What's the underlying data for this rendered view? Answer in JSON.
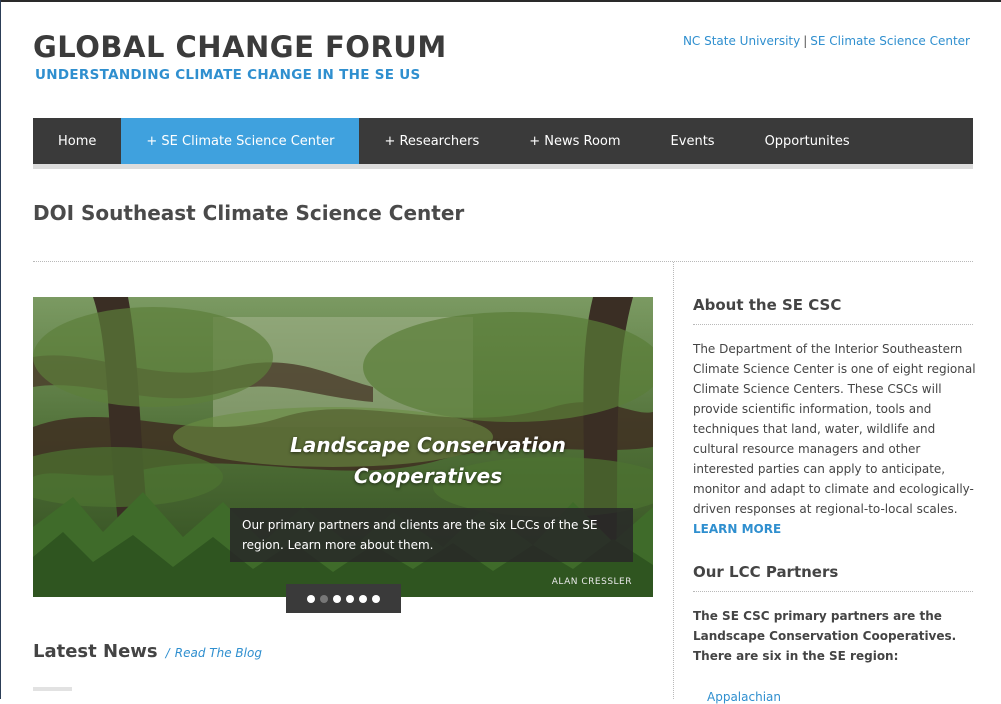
{
  "header": {
    "title": "GLOBAL CHANGE FORUM",
    "tagline": "UNDERSTANDING CLIMATE CHANGE IN THE SE US",
    "links": [
      "NC State University",
      "SE Climate Science Center"
    ],
    "link_separator": "|"
  },
  "nav": {
    "items": [
      "Home",
      "+ SE Climate Science Center",
      "+ Researchers",
      "+ News Room",
      "Events",
      "Opportunites"
    ],
    "active_index": 1
  },
  "page": {
    "title": "DOI Southeast Climate Science Center"
  },
  "slider": {
    "heading_line1": "Landscape Conservation",
    "heading_line2": "Cooperatives",
    "caption": "Our primary partners and clients are the six LCCs of the SE region. Learn more about them.",
    "credit": "ALAN CRESSLER",
    "dot_count": 6,
    "active_dot": 1
  },
  "news": {
    "heading": "Latest News",
    "separator": "/",
    "blog_link": "Read The Blog"
  },
  "sidebar": {
    "about_heading": "About the SE CSC",
    "about_text": "The Department of the Interior Southeastern Climate Science Center is one of eight regional Climate Science Centers. These CSCs will provide scientific information, tools and techniques that land, water, wildlife and cultural resource managers and other interested parties can apply to anticipate, monitor and adapt to climate and ecologically-driven responses at regional-to-local scales.",
    "about_link": "LEARN MORE",
    "partners_heading": "Our LCC Partners",
    "partners_text": "The SE CSC primary partners are the Landscape Conservation Cooperatives. There are six in the SE region:",
    "partial_item": "Appalachian"
  },
  "colors": {
    "accent": "#3fa1de",
    "nav_bg": "#3a3a3a",
    "link": "#2f8fcf"
  }
}
